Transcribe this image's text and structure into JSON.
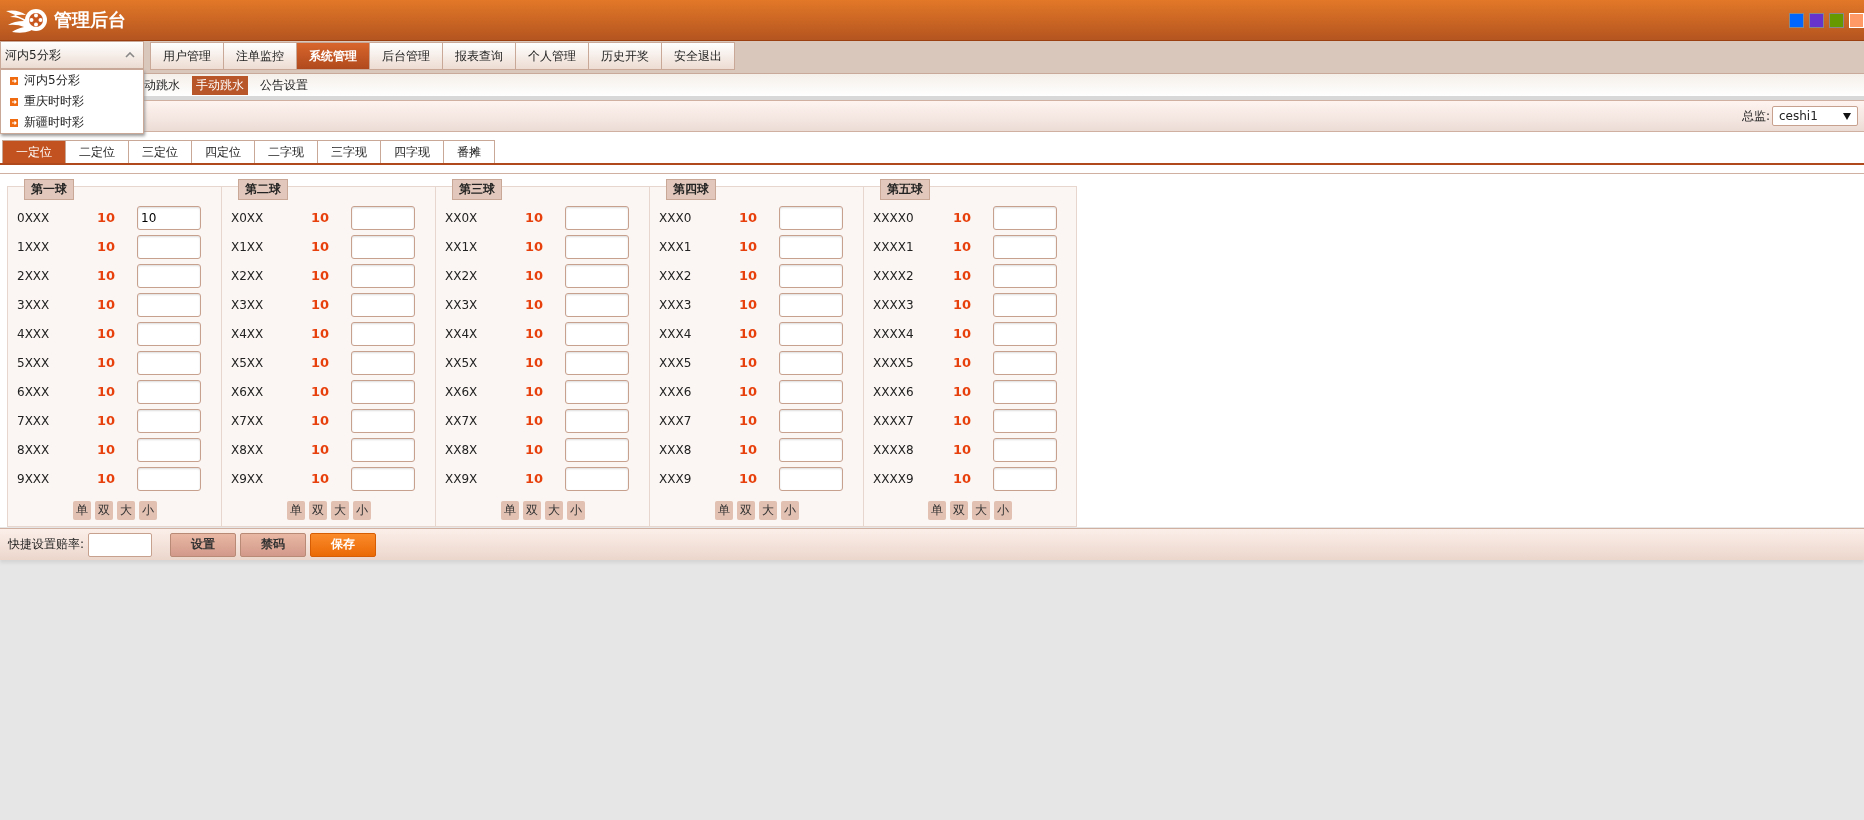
{
  "header": {
    "title": "管理后台",
    "swatches": [
      {
        "color": "#0066ff",
        "selected": false
      },
      {
        "color": "#6633cc",
        "selected": false
      },
      {
        "color": "#669900",
        "selected": false
      },
      {
        "color": "#ff9966",
        "selected": true
      }
    ]
  },
  "lottery_select": {
    "value": "河内5分彩",
    "expanded": true,
    "options": [
      "河内5分彩",
      "重庆时时彩",
      "新疆时时彩"
    ]
  },
  "nav": [
    {
      "label": "用户管理",
      "selected": false
    },
    {
      "label": "注单监控",
      "selected": false
    },
    {
      "label": "系统管理",
      "selected": true
    },
    {
      "label": "后台管理",
      "selected": false
    },
    {
      "label": "报表查询",
      "selected": false
    },
    {
      "label": "个人管理",
      "selected": false
    },
    {
      "label": "历史开奖",
      "selected": false
    },
    {
      "label": "安全退出",
      "selected": false
    }
  ],
  "subnav": [
    {
      "label": "动跳水",
      "selected": false
    },
    {
      "label": "手动跳水",
      "selected": true
    },
    {
      "label": "公告设置",
      "selected": false
    }
  ],
  "filter": {
    "label": "总监:",
    "value": "ceshi1"
  },
  "tabs": [
    {
      "label": "一定位",
      "selected": true
    },
    {
      "label": "二定位",
      "selected": false
    },
    {
      "label": "三定位",
      "selected": false
    },
    {
      "label": "四定位",
      "selected": false
    },
    {
      "label": "二字现",
      "selected": false
    },
    {
      "label": "三字现",
      "selected": false
    },
    {
      "label": "四字现",
      "selected": false
    },
    {
      "label": "番摊",
      "selected": false
    }
  ],
  "balls": [
    {
      "title": "第一球",
      "rows": [
        {
          "label": "0XXX",
          "odds": "10",
          "value": "10"
        },
        {
          "label": "1XXX",
          "odds": "10"
        },
        {
          "label": "2XXX",
          "odds": "10"
        },
        {
          "label": "3XXX",
          "odds": "10"
        },
        {
          "label": "4XXX",
          "odds": "10"
        },
        {
          "label": "5XXX",
          "odds": "10"
        },
        {
          "label": "6XXX",
          "odds": "10"
        },
        {
          "label": "7XXX",
          "odds": "10"
        },
        {
          "label": "8XXX",
          "odds": "10"
        },
        {
          "label": "9XXX",
          "odds": "10"
        }
      ],
      "buttons": [
        "单",
        "双",
        "大",
        "小"
      ]
    },
    {
      "title": "第二球",
      "rows": [
        {
          "label": "X0XX",
          "odds": "10"
        },
        {
          "label": "X1XX",
          "odds": "10"
        },
        {
          "label": "X2XX",
          "odds": "10"
        },
        {
          "label": "X3XX",
          "odds": "10"
        },
        {
          "label": "X4XX",
          "odds": "10"
        },
        {
          "label": "X5XX",
          "odds": "10"
        },
        {
          "label": "X6XX",
          "odds": "10"
        },
        {
          "label": "X7XX",
          "odds": "10"
        },
        {
          "label": "X8XX",
          "odds": "10"
        },
        {
          "label": "X9XX",
          "odds": "10"
        }
      ],
      "buttons": [
        "单",
        "双",
        "大",
        "小"
      ]
    },
    {
      "title": "第三球",
      "rows": [
        {
          "label": "XX0X",
          "odds": "10"
        },
        {
          "label": "XX1X",
          "odds": "10"
        },
        {
          "label": "XX2X",
          "odds": "10"
        },
        {
          "label": "XX3X",
          "odds": "10"
        },
        {
          "label": "XX4X",
          "odds": "10"
        },
        {
          "label": "XX5X",
          "odds": "10"
        },
        {
          "label": "XX6X",
          "odds": "10"
        },
        {
          "label": "XX7X",
          "odds": "10"
        },
        {
          "label": "XX8X",
          "odds": "10"
        },
        {
          "label": "XX9X",
          "odds": "10"
        }
      ],
      "buttons": [
        "单",
        "双",
        "大",
        "小"
      ]
    },
    {
      "title": "第四球",
      "rows": [
        {
          "label": "XXX0",
          "odds": "10"
        },
        {
          "label": "XXX1",
          "odds": "10"
        },
        {
          "label": "XXX2",
          "odds": "10"
        },
        {
          "label": "XXX3",
          "odds": "10"
        },
        {
          "label": "XXX4",
          "odds": "10"
        },
        {
          "label": "XXX5",
          "odds": "10"
        },
        {
          "label": "XXX6",
          "odds": "10"
        },
        {
          "label": "XXX7",
          "odds": "10"
        },
        {
          "label": "XXX8",
          "odds": "10"
        },
        {
          "label": "XXX9",
          "odds": "10"
        }
      ],
      "buttons": [
        "单",
        "双",
        "大",
        "小"
      ]
    },
    {
      "title": "第五球",
      "rows": [
        {
          "label": "XXXX0",
          "odds": "10"
        },
        {
          "label": "XXXX1",
          "odds": "10"
        },
        {
          "label": "XXXX2",
          "odds": "10"
        },
        {
          "label": "XXXX3",
          "odds": "10"
        },
        {
          "label": "XXXX4",
          "odds": "10"
        },
        {
          "label": "XXXX5",
          "odds": "10"
        },
        {
          "label": "XXXX6",
          "odds": "10"
        },
        {
          "label": "XXXX7",
          "odds": "10"
        },
        {
          "label": "XXXX8",
          "odds": "10"
        },
        {
          "label": "XXXX9",
          "odds": "10"
        }
      ],
      "buttons": [
        "单",
        "双",
        "大",
        "小"
      ]
    }
  ],
  "footer": {
    "label": "快捷设置赔率:",
    "buttons": [
      {
        "label": "设置",
        "kind": "normal"
      },
      {
        "label": "禁码",
        "kind": "normal"
      },
      {
        "label": "保存",
        "kind": "primary"
      }
    ]
  }
}
